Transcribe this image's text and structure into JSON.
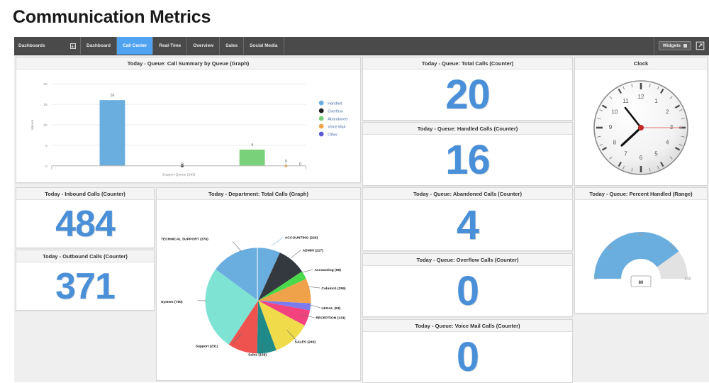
{
  "page": {
    "title": "Communication Metrics"
  },
  "nav": {
    "dashboards_label": "Dashboards",
    "grid_icon": "grid-icon",
    "tabs": [
      {
        "label": "Dashboard",
        "active": false
      },
      {
        "label": "Call Center",
        "active": true
      },
      {
        "label": "Real-Time",
        "active": false
      },
      {
        "label": "Overview",
        "active": false
      },
      {
        "label": "Sales",
        "active": false
      },
      {
        "label": "Social Media",
        "active": false
      }
    ],
    "widgets_label": "Widgets",
    "expand_icon": "expand-icon"
  },
  "colors": {
    "accent_blue": "#4a90d9",
    "nav_active": "#4fa3f0",
    "bar_handled": "#6aaee0",
    "bar_abandoned": "#79d279",
    "gauge_fill": "#6aaee0",
    "gauge_track": "#e2e2e2"
  },
  "panels": {
    "queue_call_summary": {
      "title": "Today - Queue: Call Summary by Queue (Graph)"
    },
    "queue_total_calls": {
      "title": "Today - Queue: Total Calls (Counter)",
      "value": "20"
    },
    "queue_handled_calls": {
      "title": "Today - Queue: Handled Calls (Counter)",
      "value": "16"
    },
    "clock": {
      "title": "Clock",
      "time": "10:37",
      "hour_hand": 10,
      "minute_hand": 37,
      "second_hand": 15
    },
    "inbound_calls": {
      "title": "Today - Inbound Calls (Counter)",
      "value": "484"
    },
    "outbound_calls": {
      "title": "Today - Outbound Calls (Counter)",
      "value": "371"
    },
    "department_total_calls": {
      "title": "Today - Department: Total Calls (Graph)"
    },
    "queue_abandoned_calls": {
      "title": "Today - Queue: Abandoned Calls (Counter)",
      "value": "4"
    },
    "queue_overflow_calls": {
      "title": "Today - Queue: Overflow Calls (Counter)",
      "value": "0"
    },
    "queue_voicemail_calls": {
      "title": "Today - Queue: Voice Mail Calls (Counter)",
      "value": "0"
    },
    "queue_percent_handled": {
      "title": "Today - Queue: Percent Handled (Range)"
    }
  },
  "chart_data": [
    {
      "id": "queue_call_summary",
      "type": "bar",
      "title": "Today - Queue: Call Summary by Queue (Graph)",
      "xlabel": "Support Queue (283)",
      "ylabel": "Values",
      "categories": [
        "Handled",
        "Overflow",
        "Abandoned",
        "Voice Mail",
        "Other"
      ],
      "values": [
        16,
        0,
        4,
        0,
        0
      ],
      "value_labels": [
        "16",
        "0",
        "4",
        "0",
        "0"
      ],
      "colors": [
        "#6aaee0",
        "#222222",
        "#79d279",
        "#f0a44a",
        "#5b5bd6"
      ],
      "ylim": [
        0,
        20
      ],
      "yticks": [
        "0",
        "5",
        "10",
        "15",
        "20"
      ],
      "grid": true,
      "legend_position": "right",
      "legend": [
        "Handled",
        "Overflow",
        "Abandoned",
        "Voice Mail",
        "Other"
      ]
    },
    {
      "id": "department_total_calls",
      "type": "pie",
      "title": "Today - Department: Total Calls (Graph)",
      "labels": [
        "ACCOUNTING (226)",
        "ADMIN (217)",
        "Accounting (66)",
        "Column1 (259)",
        "LEGAL (53)",
        "RECEPTION (131)",
        "SALES (240)",
        "Sales (158)",
        "Support (231)",
        "System (790)",
        "TECHNICAL SUPPORT (376)"
      ],
      "values": [
        226,
        217,
        66,
        259,
        53,
        131,
        240,
        158,
        231,
        790,
        376
      ],
      "colors": [
        "#6aaee0",
        "#33393f",
        "#4ad94a",
        "#f0a24a",
        "#7b7bf0",
        "#f2437f",
        "#f0db4a",
        "#1f8a87",
        "#ef5350",
        "#7fe3d4",
        "#6aaee0"
      ],
      "legend_position": "callout-labels"
    },
    {
      "id": "queue_percent_handled",
      "type": "gauge",
      "title": "Today - Queue: Percent Handled (Range)",
      "value": 80,
      "value_label": "80",
      "min": 0,
      "max": 100,
      "ticks": [
        "0",
        "25",
        "50",
        "75",
        "100"
      ],
      "fill_color": "#6aaee0",
      "track_color": "#e2e2e2"
    }
  ]
}
